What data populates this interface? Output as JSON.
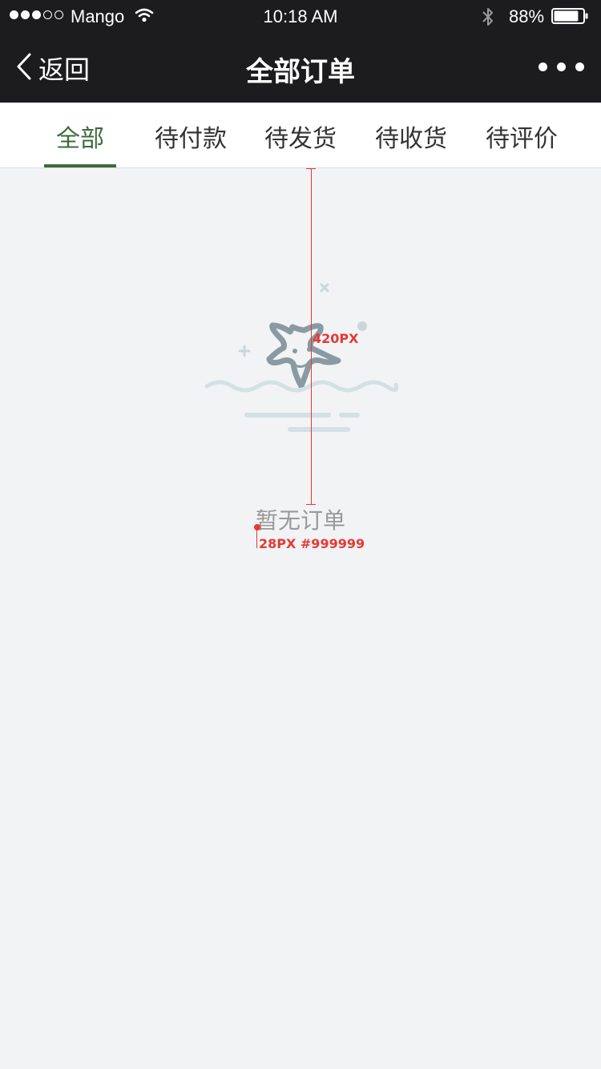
{
  "status_bar": {
    "carrier": "Mango",
    "time": "10:18 AM",
    "battery_percent": "88%",
    "battery_level": 0.88,
    "signal_bars_filled": 3,
    "signal_bars_total": 5
  },
  "nav": {
    "back_label": "返回",
    "title": "全部订单"
  },
  "tabs": [
    {
      "label": "全部"
    },
    {
      "label": "待付款"
    },
    {
      "label": "待发货"
    },
    {
      "label": "待收货"
    },
    {
      "label": "待评价"
    }
  ],
  "active_tab_index": 0,
  "empty_state": {
    "message": "暂无订单"
  },
  "annotations": {
    "distance_label": "420PX",
    "text_spec_label": "28PX #999999"
  },
  "colors": {
    "accent": "#3b6b3b",
    "header_bg": "#1c1c1e",
    "page_bg": "#f2f3f5",
    "empty_text": "#999999",
    "annotation": "#e53935"
  }
}
